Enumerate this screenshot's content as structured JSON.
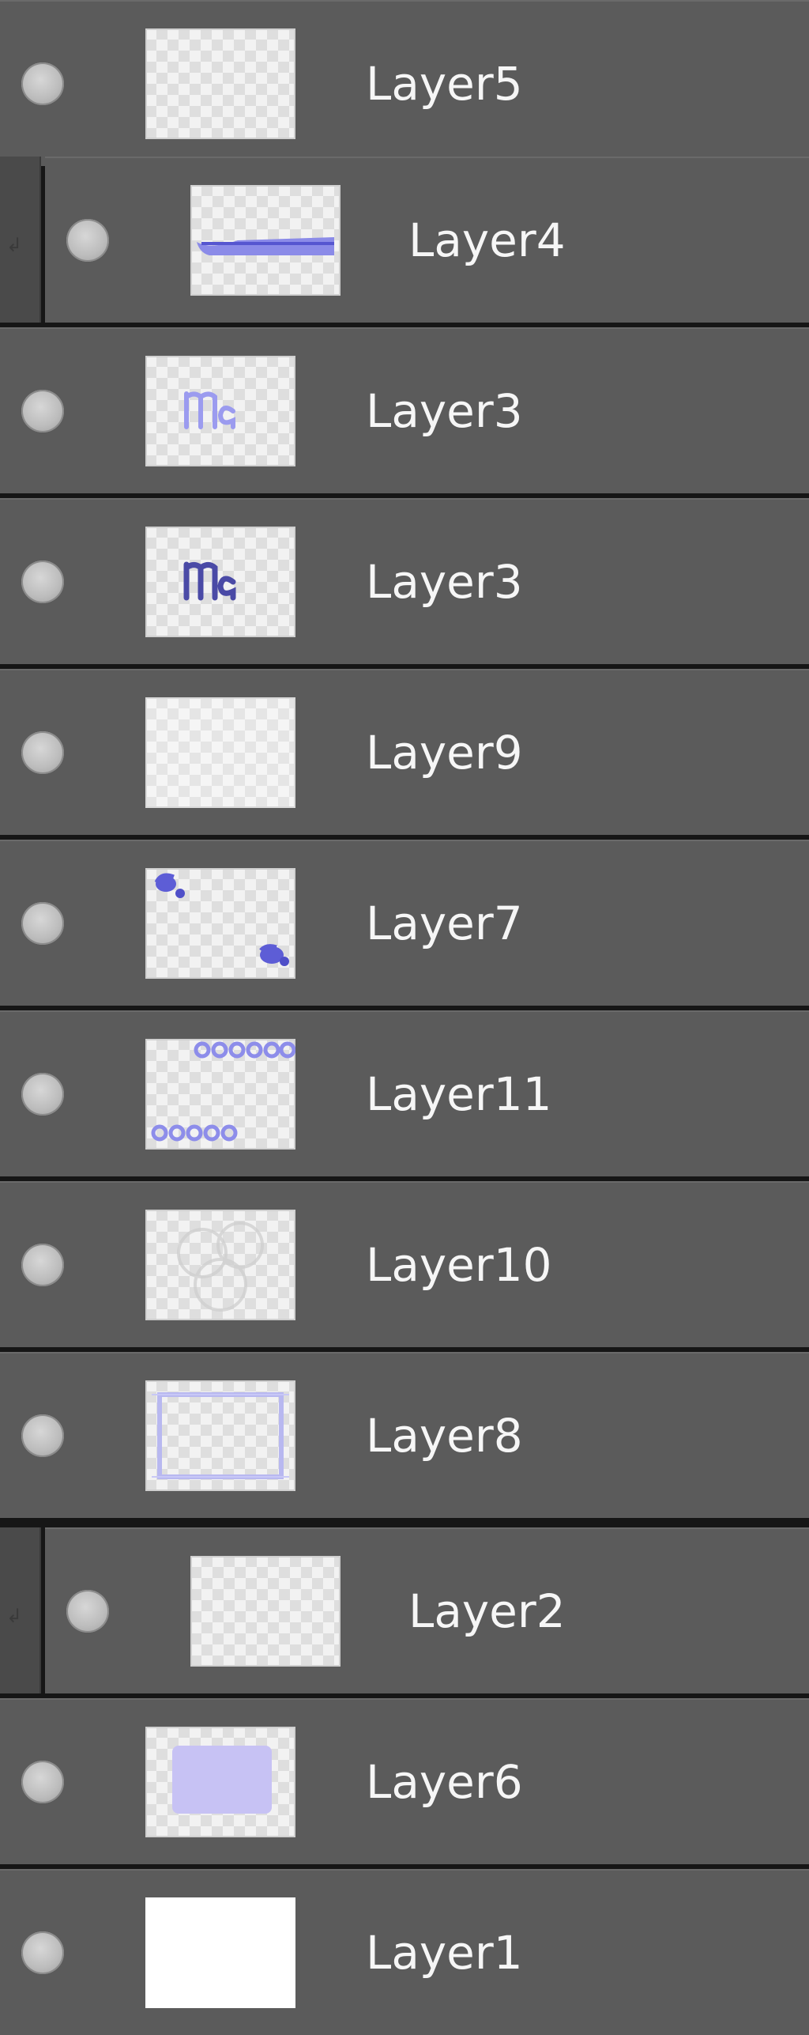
{
  "layers": [
    {
      "name": "Layer5",
      "visible": true,
      "clipped": false,
      "thumb": "blank"
    },
    {
      "name": "Layer4",
      "visible": true,
      "clipped": true,
      "thumb": "stroke"
    },
    {
      "name": "Layer3",
      "visible": true,
      "clipped": false,
      "thumb": "text-light"
    },
    {
      "name": "Layer3",
      "visible": true,
      "clipped": false,
      "thumb": "text-dark"
    },
    {
      "name": "Layer9",
      "visible": true,
      "clipped": false,
      "thumb": "blank-light"
    },
    {
      "name": "Layer7",
      "visible": true,
      "clipped": false,
      "thumb": "blobs"
    },
    {
      "name": "Layer11",
      "visible": true,
      "clipped": false,
      "thumb": "circles"
    },
    {
      "name": "Layer10",
      "visible": true,
      "clipped": false,
      "thumb": "faint-rings"
    },
    {
      "name": "Layer8",
      "visible": true,
      "clipped": false,
      "thumb": "frame"
    },
    {
      "name": "Layer2",
      "visible": true,
      "clipped": true,
      "thumb": "blank"
    },
    {
      "name": "Layer6",
      "visible": true,
      "clipped": false,
      "thumb": "box"
    },
    {
      "name": "Layer1",
      "visible": true,
      "clipped": false,
      "thumb": "white"
    }
  ],
  "colors": {
    "background": "#161616",
    "row": "#5b5b5b",
    "clip_bar": "#4a4a4a",
    "text": "#f6f6f6",
    "accent": "#6f6fe0",
    "accent_light": "#b8b8f0"
  },
  "icons": {
    "visibility": "eye-icon",
    "clipping": "clip-arrow-icon"
  }
}
